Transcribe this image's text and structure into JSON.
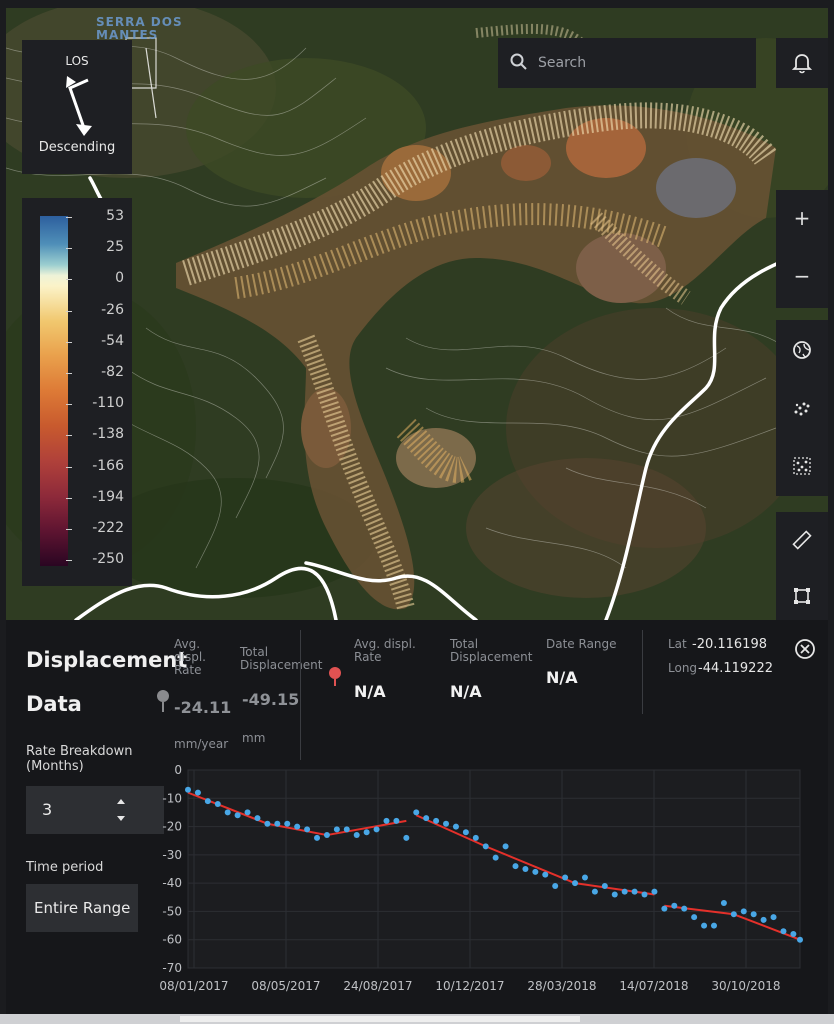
{
  "map": {
    "overlay_label": "SERRA DOS\nMANTES",
    "los": {
      "top_label": "LOS",
      "bottom_label": "Descending"
    },
    "legend": {
      "ticks": [
        "53",
        "25",
        "0",
        "-26",
        "-54",
        "-82",
        "-110",
        "-138",
        "-166",
        "-194",
        "-222",
        "-250"
      ]
    },
    "search": {
      "placeholder": "Search",
      "icon": "search-icon"
    },
    "bell_icon": "bell-icon",
    "zoom": {
      "in_label": "+",
      "out_label": "−"
    },
    "tools": [
      "globe-icon",
      "scatter-points-icon",
      "scatter-select-icon",
      "ruler-icon",
      "crop-select-icon"
    ]
  },
  "panel": {
    "title_line1": "Displacement",
    "title_line2": "Data",
    "selected_point": {
      "marker_color": "#8a8b8e",
      "avg_rate_label": "Avg. displ. Rate",
      "avg_rate_value": "-24.11",
      "avg_rate_unit": "mm/year",
      "total_label": "Total Displacement",
      "total_value": "-49.15",
      "total_unit": "mm"
    },
    "compare_point": {
      "marker_color": "#e05252",
      "avg_rate_label": "Avg. displ. Rate",
      "avg_rate_value": "N/A",
      "total_label": "Total Displacement",
      "total_value": "N/A",
      "date_range_label": "Date Range",
      "date_range_value": "N/A"
    },
    "coords": {
      "lat_label": "Lat",
      "lat_value": "-20.116198",
      "long_label": "Long",
      "long_value": "-44.119222"
    },
    "rate_breakdown_label": "Rate Breakdown\n(Months)",
    "rate_breakdown_value": "3",
    "time_period_label": "Time period",
    "time_period_value": "Entire Range",
    "close_icon": "close-circle-icon"
  },
  "chart_data": {
    "type": "scatter",
    "x_tick_labels": [
      "08/01/2017",
      "08/05/2017",
      "24/08/2017",
      "10/12/2017",
      "28/03/2018",
      "14/07/2018",
      "30/10/2018"
    ],
    "y_ticks": [
      0,
      -10,
      -20,
      -30,
      -40,
      -50,
      -60,
      -70
    ],
    "ylim": [
      -70,
      0
    ],
    "x_start": "2017-01-08",
    "x_end": "2019-01-18",
    "grid": true,
    "point_color": "#49a7e6",
    "trend_color": "#e4302a",
    "points": [
      [
        "2017-01-08",
        -7
      ],
      [
        "2017-01-20",
        -8
      ],
      [
        "2017-02-01",
        -11
      ],
      [
        "2017-02-13",
        -12
      ],
      [
        "2017-02-25",
        -15
      ],
      [
        "2017-03-09",
        -16
      ],
      [
        "2017-03-21",
        -15
      ],
      [
        "2017-04-02",
        -17
      ],
      [
        "2017-04-14",
        -19
      ],
      [
        "2017-04-26",
        -19
      ],
      [
        "2017-05-08",
        -19
      ],
      [
        "2017-05-20",
        -20
      ],
      [
        "2017-06-01",
        -21
      ],
      [
        "2017-06-13",
        -24
      ],
      [
        "2017-06-25",
        -23
      ],
      [
        "2017-07-07",
        -21
      ],
      [
        "2017-07-19",
        -21
      ],
      [
        "2017-07-31",
        -23
      ],
      [
        "2017-08-12",
        -22
      ],
      [
        "2017-08-24",
        -21
      ],
      [
        "2017-09-05",
        -18
      ],
      [
        "2017-09-17",
        -18
      ],
      [
        "2017-09-29",
        -24
      ],
      [
        "2017-10-11",
        -15
      ],
      [
        "2017-10-23",
        -17
      ],
      [
        "2017-11-04",
        -18
      ],
      [
        "2017-11-16",
        -19
      ],
      [
        "2017-11-28",
        -20
      ],
      [
        "2017-12-10",
        -22
      ],
      [
        "2017-12-22",
        -24
      ],
      [
        "2018-01-03",
        -27
      ],
      [
        "2018-01-15",
        -31
      ],
      [
        "2018-01-27",
        -27
      ],
      [
        "2018-02-08",
        -34
      ],
      [
        "2018-02-20",
        -35
      ],
      [
        "2018-03-04",
        -36
      ],
      [
        "2018-03-16",
        -37
      ],
      [
        "2018-03-28",
        -41
      ],
      [
        "2018-04-09",
        -38
      ],
      [
        "2018-04-21",
        -40
      ],
      [
        "2018-05-03",
        -38
      ],
      [
        "2018-05-15",
        -43
      ],
      [
        "2018-05-27",
        -41
      ],
      [
        "2018-06-08",
        -44
      ],
      [
        "2018-06-20",
        -43
      ],
      [
        "2018-07-02",
        -43
      ],
      [
        "2018-07-14",
        -44
      ],
      [
        "2018-07-26",
        -43
      ],
      [
        "2018-08-07",
        -49
      ],
      [
        "2018-08-19",
        -48
      ],
      [
        "2018-08-31",
        -49
      ],
      [
        "2018-09-12",
        -52
      ],
      [
        "2018-09-24",
        -55
      ],
      [
        "2018-10-06",
        -55
      ],
      [
        "2018-10-18",
        -47
      ],
      [
        "2018-10-30",
        -51
      ],
      [
        "2018-11-11",
        -50
      ],
      [
        "2018-11-23",
        -51
      ],
      [
        "2018-12-05",
        -53
      ],
      [
        "2018-12-17",
        -52
      ],
      [
        "2018-12-29",
        -57
      ],
      [
        "2019-01-10",
        -58
      ],
      [
        "2019-01-18",
        -60
      ]
    ],
    "trend_segments": [
      [
        [
          "2017-01-08",
          -8
        ],
        [
          "2017-04-14",
          -19
        ]
      ],
      [
        [
          "2017-04-14",
          -19
        ],
        [
          "2017-06-25",
          -23
        ]
      ],
      [
        [
          "2017-06-25",
          -23
        ],
        [
          "2017-09-29",
          -18
        ]
      ],
      [
        [
          "2017-10-11",
          -16
        ],
        [
          "2018-01-03",
          -27
        ]
      ],
      [
        [
          "2018-01-03",
          -27
        ],
        [
          "2018-04-21",
          -40
        ]
      ],
      [
        [
          "2018-04-21",
          -40
        ],
        [
          "2018-07-26",
          -44
        ]
      ],
      [
        [
          "2018-08-07",
          -48
        ],
        [
          "2018-10-30",
          -51
        ]
      ],
      [
        [
          "2018-10-30",
          -51
        ],
        [
          "2019-01-18",
          -60
        ]
      ]
    ]
  }
}
